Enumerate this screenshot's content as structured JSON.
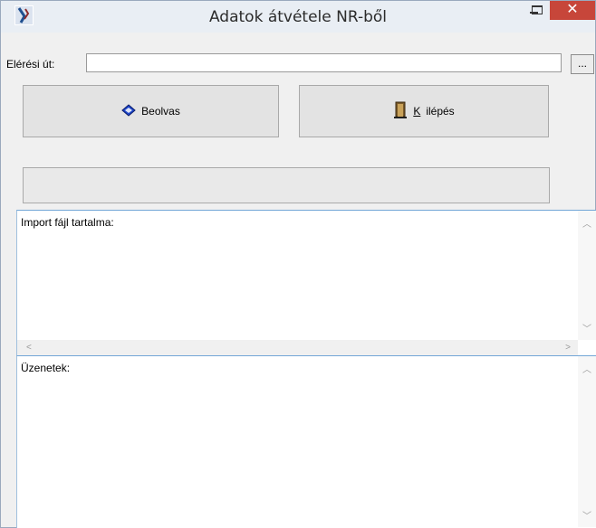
{
  "window": {
    "title": "Adatok átvétele NR-ből",
    "close_glyph": "✕"
  },
  "form": {
    "path_label": "Elérési út:",
    "path_value": "",
    "browse_label": "...",
    "read_label": "Beolvas",
    "exit_label": "Kilépés",
    "exit_mnemonic": "K",
    "status_text": ""
  },
  "import_pane": {
    "label": "Import fájl tartalma:"
  },
  "messages_pane": {
    "label": "Üzenetek:"
  },
  "icons": {
    "app": "app-icon",
    "read": "blue-diamond-icon",
    "exit": "exit-door-icon"
  },
  "colors": {
    "close_button": "#c7463a",
    "accent": "#72a6d6"
  }
}
